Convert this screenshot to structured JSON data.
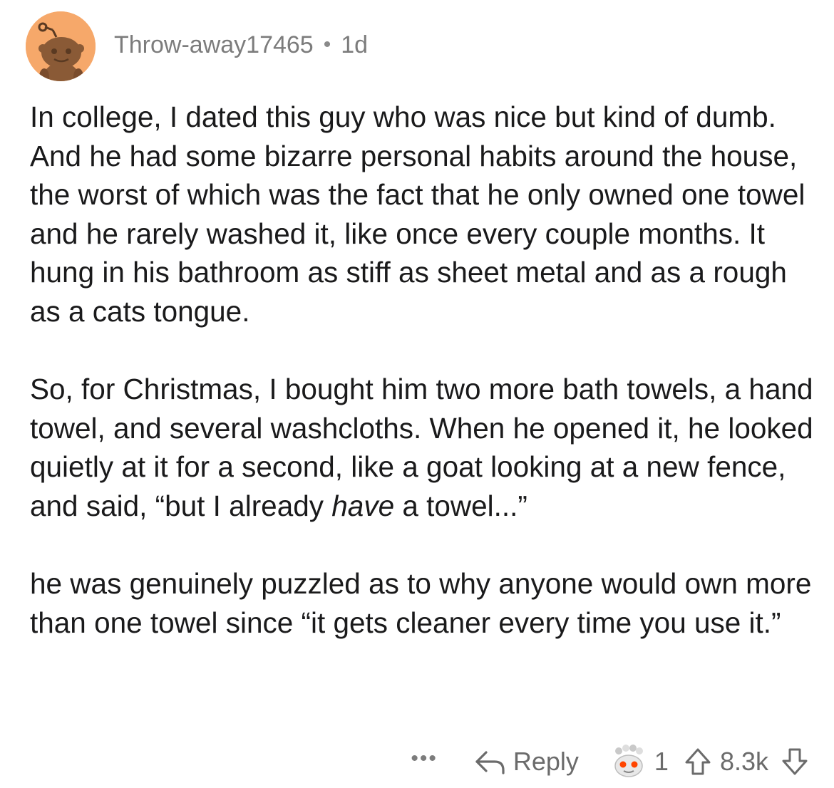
{
  "comment": {
    "username": "Throw-away17465",
    "separator": "•",
    "age": "1d",
    "paragraph1": "In college, I dated this guy who was nice but kind of dumb. And he had some bizarre personal habits around the house, the worst of which was the fact that he only owned one towel and he rarely washed it, like once every couple months. It hung in his bathroom as stiff as sheet metal and as a rough as a cats tongue.",
    "paragraph2_before": "So, for Christmas, I bought him two more bath towels, a hand towel, and several washcloths. When he opened it, he looked quietly at it for a second, like a goat looking at a new fence, and said, “but I already ",
    "paragraph2_emphasis": "have",
    "paragraph2_after": " a towel...”",
    "paragraph3": "he was genuinely puzzled as to why anyone would own more than one towel since “it gets cleaner every time you use it.”"
  },
  "actions": {
    "more_label": "•••",
    "reply_label": "Reply",
    "award_count": "1",
    "score": "8.3k"
  },
  "icons": {
    "avatar": "snoo-avatar-icon",
    "reply": "reply-arrow-icon",
    "award": "award-icon",
    "upvote": "upvote-arrow-icon",
    "downvote": "downvote-arrow-icon"
  },
  "colors": {
    "avatar_background": "#f6a86a",
    "text": "#1a1a1b",
    "meta_text": "#7c7c7c",
    "action_text": "#6b6b6b"
  }
}
